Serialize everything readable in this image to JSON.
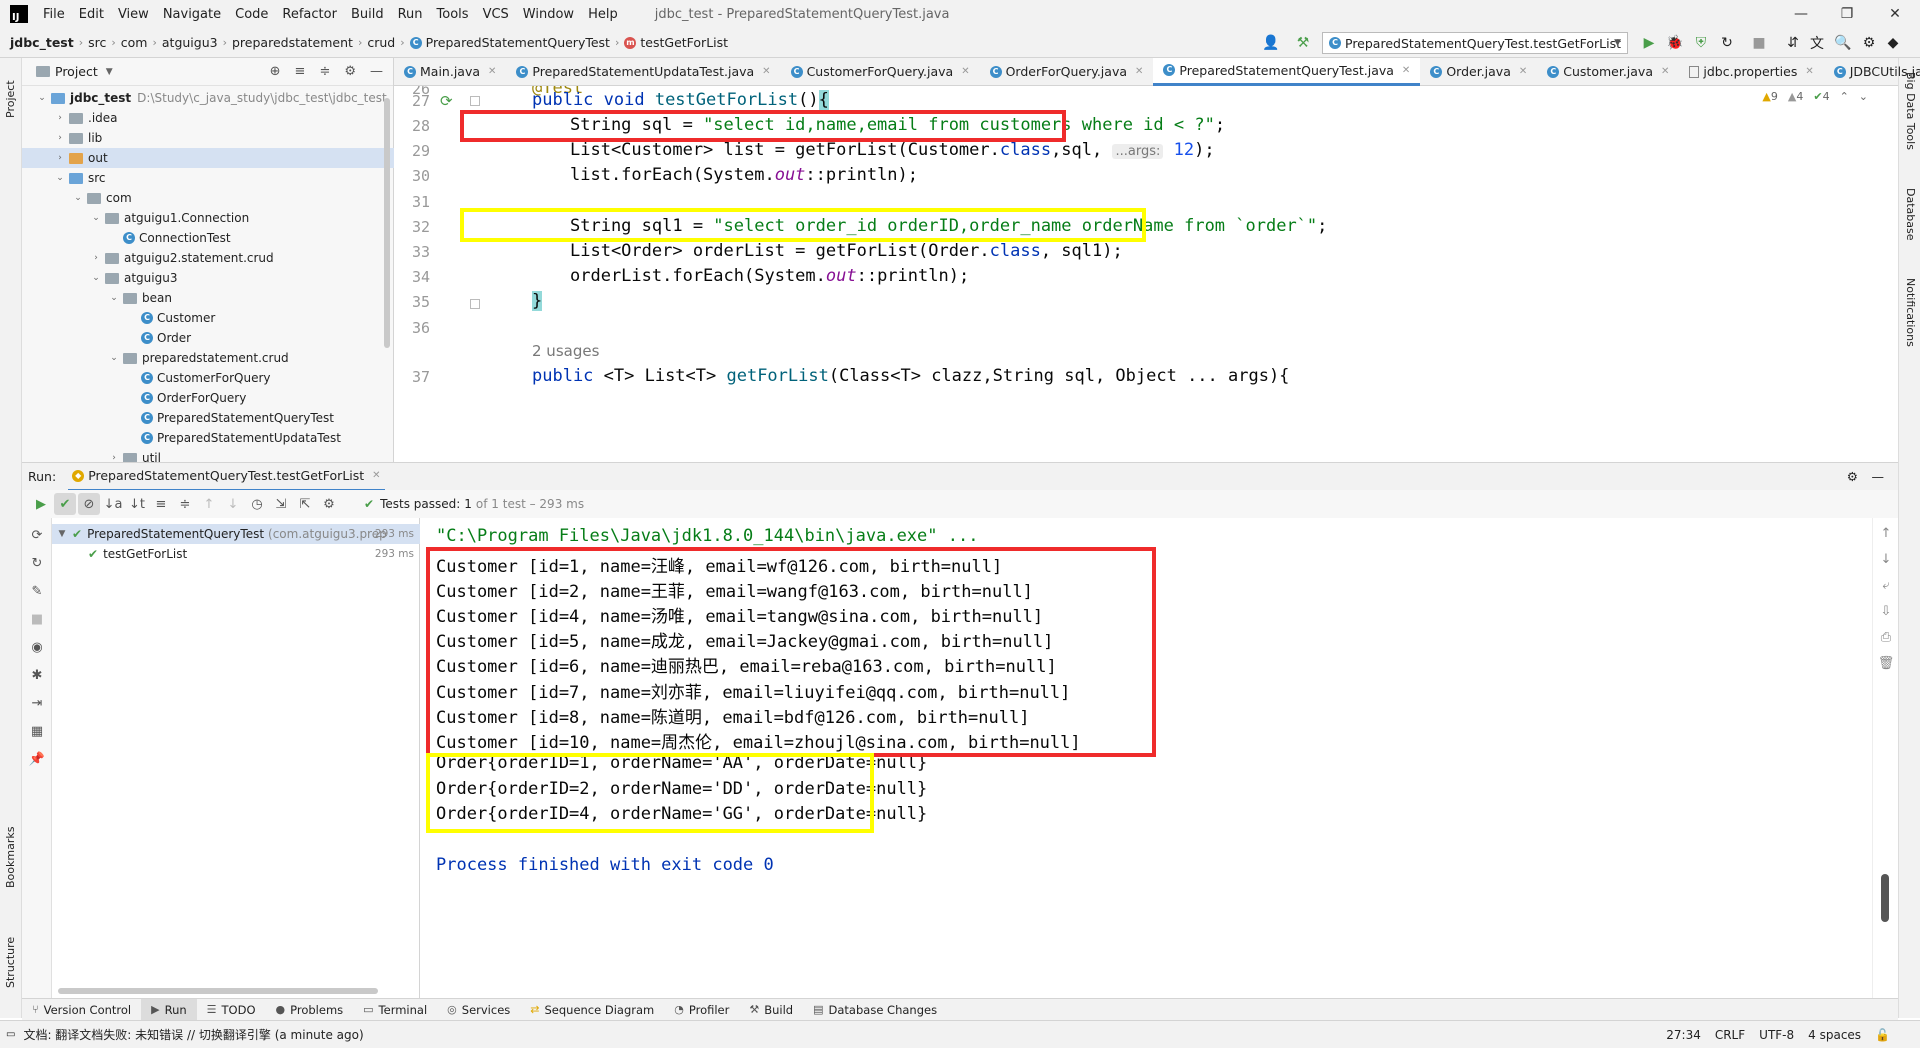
{
  "menubar": {
    "logo": "IJ",
    "items": [
      "File",
      "Edit",
      "View",
      "Navigate",
      "Code",
      "Refactor",
      "Build",
      "Run",
      "Tools",
      "VCS",
      "Window",
      "Help"
    ],
    "window_title": "jdbc_test - PreparedStatementQueryTest.java",
    "controls": [
      "—",
      "❐",
      "✕"
    ]
  },
  "navbar": {
    "breadcrumbs": [
      "jdbc_test",
      "src",
      "com",
      "atguigu3",
      "preparedstatement",
      "crud",
      "PreparedStatementQueryTest",
      "testGetForList"
    ],
    "run_config": "PreparedStatementQueryTest.testGetForList"
  },
  "left_stripe": {
    "project": "Project",
    "bookmarks": "Bookmarks",
    "structure": "Structure"
  },
  "right_stripe": {
    "big_data_tools": "Big Data Tools",
    "database": "Database",
    "notifications": "Notifications"
  },
  "project_panel": {
    "title": "Project",
    "tree": [
      {
        "label": "jdbc_test",
        "sub": "D:\\Study\\c_java_study\\jdbc_test\\jdbc_test",
        "level": 0,
        "expanded": true,
        "kind": "module"
      },
      {
        "label": ".idea",
        "level": 1,
        "expanded": false,
        "kind": "folder"
      },
      {
        "label": "lib",
        "level": 1,
        "expanded": false,
        "kind": "folder"
      },
      {
        "label": "out",
        "level": 1,
        "expanded": false,
        "kind": "folder-orange",
        "selected": true
      },
      {
        "label": "src",
        "level": 1,
        "expanded": true,
        "kind": "folder-blue"
      },
      {
        "label": "com",
        "level": 2,
        "expanded": true,
        "kind": "pkg"
      },
      {
        "label": "atguigu1.Connection",
        "level": 3,
        "expanded": true,
        "kind": "pkg"
      },
      {
        "label": "ConnectionTest",
        "level": 4,
        "kind": "class"
      },
      {
        "label": "atguigu2.statement.crud",
        "level": 3,
        "expanded": false,
        "kind": "pkg"
      },
      {
        "label": "atguigu3",
        "level": 3,
        "expanded": true,
        "kind": "pkg"
      },
      {
        "label": "bean",
        "level": 4,
        "expanded": true,
        "kind": "pkg"
      },
      {
        "label": "Customer",
        "level": 5,
        "kind": "class"
      },
      {
        "label": "Order",
        "level": 5,
        "kind": "class"
      },
      {
        "label": "preparedstatement.crud",
        "level": 4,
        "expanded": true,
        "kind": "pkg"
      },
      {
        "label": "CustomerForQuery",
        "level": 5,
        "kind": "class"
      },
      {
        "label": "OrderForQuery",
        "level": 5,
        "kind": "class"
      },
      {
        "label": "PreparedStatementQueryTest",
        "level": 5,
        "kind": "class"
      },
      {
        "label": "PreparedStatementUpdataTest",
        "level": 5,
        "kind": "class"
      },
      {
        "label": "util",
        "level": 4,
        "expanded": false,
        "kind": "pkg"
      }
    ]
  },
  "editor_tabs": [
    {
      "label": "Main.java",
      "active": false
    },
    {
      "label": "PreparedStatementUpdataTest.java",
      "active": false
    },
    {
      "label": "CustomerForQuery.java",
      "active": false
    },
    {
      "label": "OrderForQuery.java",
      "active": false
    },
    {
      "label": "PreparedStatementQueryTest.java",
      "active": true
    },
    {
      "label": "Order.java",
      "active": false
    },
    {
      "label": "Customer.java",
      "active": false
    },
    {
      "label": "jdbc.properties",
      "active": false
    },
    {
      "label": "JDBCUtils.java",
      "active": false
    }
  ],
  "editor": {
    "warnings": {
      "warn": "9",
      "weak": "4",
      "ok": "4"
    },
    "line_numbers": [
      "26",
      "27",
      "28",
      "29",
      "30",
      "31",
      "32",
      "33",
      "34",
      "35",
      "36",
      "",
      "37"
    ],
    "usages": "2 usages",
    "code": {
      "l26": "@Test",
      "l27a": "public void ",
      "l27b": "testGetForList",
      "l27c": "()",
      "l27d": "{",
      "l28a": "String sql = ",
      "l28b": "\"select id,name,email from customers where id < ?\"",
      "l28c": ";",
      "l29a": "List<Customer> list = getForList(Customer.",
      "l29b": "class",
      "l29c": ",sql, ",
      "l29hint": "...args:",
      "l29d": " 12",
      "l29e": ");",
      "l30a": "list.forEach(System.",
      "l30b": "out",
      "l30c": "::println);",
      "l32a": "String sql1 = ",
      "l32b": "\"select order_id orderID,order_name orderName from `order`\"",
      "l32c": ";",
      "l33a": "List<Order> orderList = getForList(Order.",
      "l33b": "class",
      "l33c": ", sql1);",
      "l34a": "orderList.forEach(System.",
      "l34b": "out",
      "l34c": "::println);",
      "l35": "}",
      "l37a": "public ",
      "l37b": "<T> List<T> ",
      "l37c": "getForList",
      "l37d": "(Class<T> clazz,String sql, Object ... args){"
    }
  },
  "run_panel": {
    "label": "Run:",
    "tab": "PreparedStatementQueryTest.testGetForList",
    "tests_passed": "Tests passed:",
    "count": "1",
    "of_total": "of 1 test – 293 ms",
    "tree": [
      {
        "label": "PreparedStatementQueryTest",
        "pkg": "(com.atguigu3.prep",
        "time": "293 ms"
      },
      {
        "label": "testGetForList",
        "pkg": "",
        "time": "293 ms"
      }
    ],
    "console": {
      "cmd": "\"C:\\Program Files\\Java\\jdk1.8.0_144\\bin\\java.exe\" ...",
      "customers": [
        "Customer [id=1, name=汪峰, email=wf@126.com, birth=null]",
        "Customer [id=2, name=王菲, email=wangf@163.com, birth=null]",
        "Customer [id=4, name=汤唯, email=tangw@sina.com, birth=null]",
        "Customer [id=5, name=成龙, email=Jackey@gmai.com, birth=null]",
        "Customer [id=6, name=迪丽热巴, email=reba@163.com, birth=null]",
        "Customer [id=7, name=刘亦菲, email=liuyifei@qq.com, birth=null]",
        "Customer [id=8, name=陈道明, email=bdf@126.com, birth=null]",
        "Customer [id=10, name=周杰伦, email=zhoujl@sina.com, birth=null]"
      ],
      "orders": [
        "Order{orderID=1, orderName='AA', orderDate=null}",
        "Order{orderID=2, orderName='DD', orderDate=null}",
        "Order{orderID=4, orderName='GG', orderDate=null}"
      ],
      "exit": "Process finished with exit code 0"
    }
  },
  "bottom_tabs": [
    "Version Control",
    "Run",
    "TODO",
    "Problems",
    "Terminal",
    "Services",
    "Sequence Diagram",
    "Profiler",
    "Build",
    "Database Changes"
  ],
  "status_bar": {
    "message": "文档: 翻译文档失败: 未知错误 // 切换翻译引擎 (a minute ago)",
    "position": "27:34",
    "line_sep": "CRLF",
    "encoding": "UTF-8",
    "indent": "4 spaces"
  },
  "colors": {
    "highlight_red": "#ef2b2b",
    "highlight_yellow": "#ffff00",
    "keyword": "#0033b3",
    "string": "#067d17",
    "accent": "#4083c9"
  }
}
